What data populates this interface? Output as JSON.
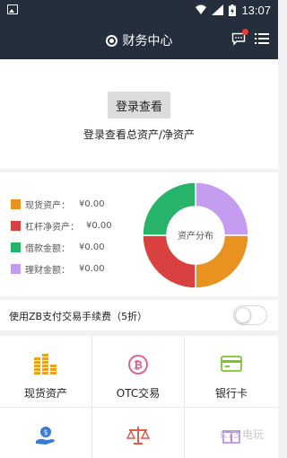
{
  "status_bar": {
    "time": "13:07"
  },
  "header": {
    "title": "财务中心"
  },
  "login": {
    "button_label": "登录查看",
    "hint": "登录查看总资产/净资产"
  },
  "assets": {
    "center_label": "资产分布",
    "items": [
      {
        "label": "现货资产：",
        "value": "¥0.00",
        "color": "#e8921f"
      },
      {
        "label": "杠杆净资产：",
        "value": "¥0.00",
        "color": "#d94040"
      },
      {
        "label": "借款金额：",
        "value": "¥0.00",
        "color": "#27b36a"
      },
      {
        "label": "理财金额：",
        "value": "¥0.00",
        "color": "#c39bef"
      }
    ]
  },
  "fee": {
    "label": "使用ZB支付交易手续费（5折）",
    "enabled": false
  },
  "grid": {
    "items": [
      {
        "label": "现货资产",
        "icon": "coins-stack-icon"
      },
      {
        "label": "OTC交易",
        "icon": "bitcoin-icon"
      },
      {
        "label": "银行卡",
        "icon": "bank-card-icon"
      },
      {
        "label": "",
        "icon": "hand-coin-icon"
      },
      {
        "label": "",
        "icon": "scale-icon"
      },
      {
        "label": "",
        "icon": "gift-icon"
      }
    ]
  },
  "watermark": "K73 电玩"
}
